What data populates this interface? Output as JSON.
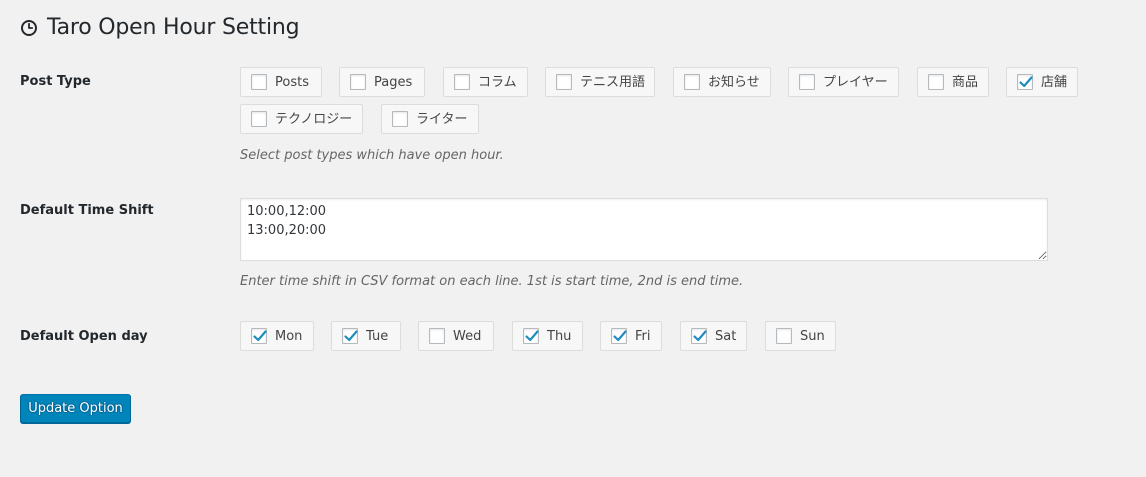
{
  "header": {
    "title": "Taro Open Hour Setting",
    "icon": "clock-icon"
  },
  "post_type": {
    "label": "Post Type",
    "options": [
      {
        "label": "Posts",
        "checked": false
      },
      {
        "label": "Pages",
        "checked": false
      },
      {
        "label": "コラム",
        "checked": false
      },
      {
        "label": "テニス用語",
        "checked": false
      },
      {
        "label": "お知らせ",
        "checked": false
      },
      {
        "label": "プレイヤー",
        "checked": false
      },
      {
        "label": "商品",
        "checked": false
      },
      {
        "label": "店舗",
        "checked": true
      },
      {
        "label": "テクノロジー",
        "checked": false
      },
      {
        "label": "ライター",
        "checked": false
      }
    ],
    "description": "Select post types which have open hour."
  },
  "time_shift": {
    "label": "Default Time Shift",
    "value": "10:00,12:00\n13:00,20:00",
    "description": "Enter time shift in CSV format on each line. 1st is start time, 2nd is end time."
  },
  "open_day": {
    "label": "Default Open day",
    "options": [
      {
        "label": "Mon",
        "checked": true
      },
      {
        "label": "Tue",
        "checked": true
      },
      {
        "label": "Wed",
        "checked": false
      },
      {
        "label": "Thu",
        "checked": true
      },
      {
        "label": "Fri",
        "checked": true
      },
      {
        "label": "Sat",
        "checked": true
      },
      {
        "label": "Sun",
        "checked": false
      }
    ]
  },
  "submit": {
    "label": "Update Option"
  },
  "colors": {
    "accent": "#0085ba",
    "check": "#1e8cbe"
  }
}
